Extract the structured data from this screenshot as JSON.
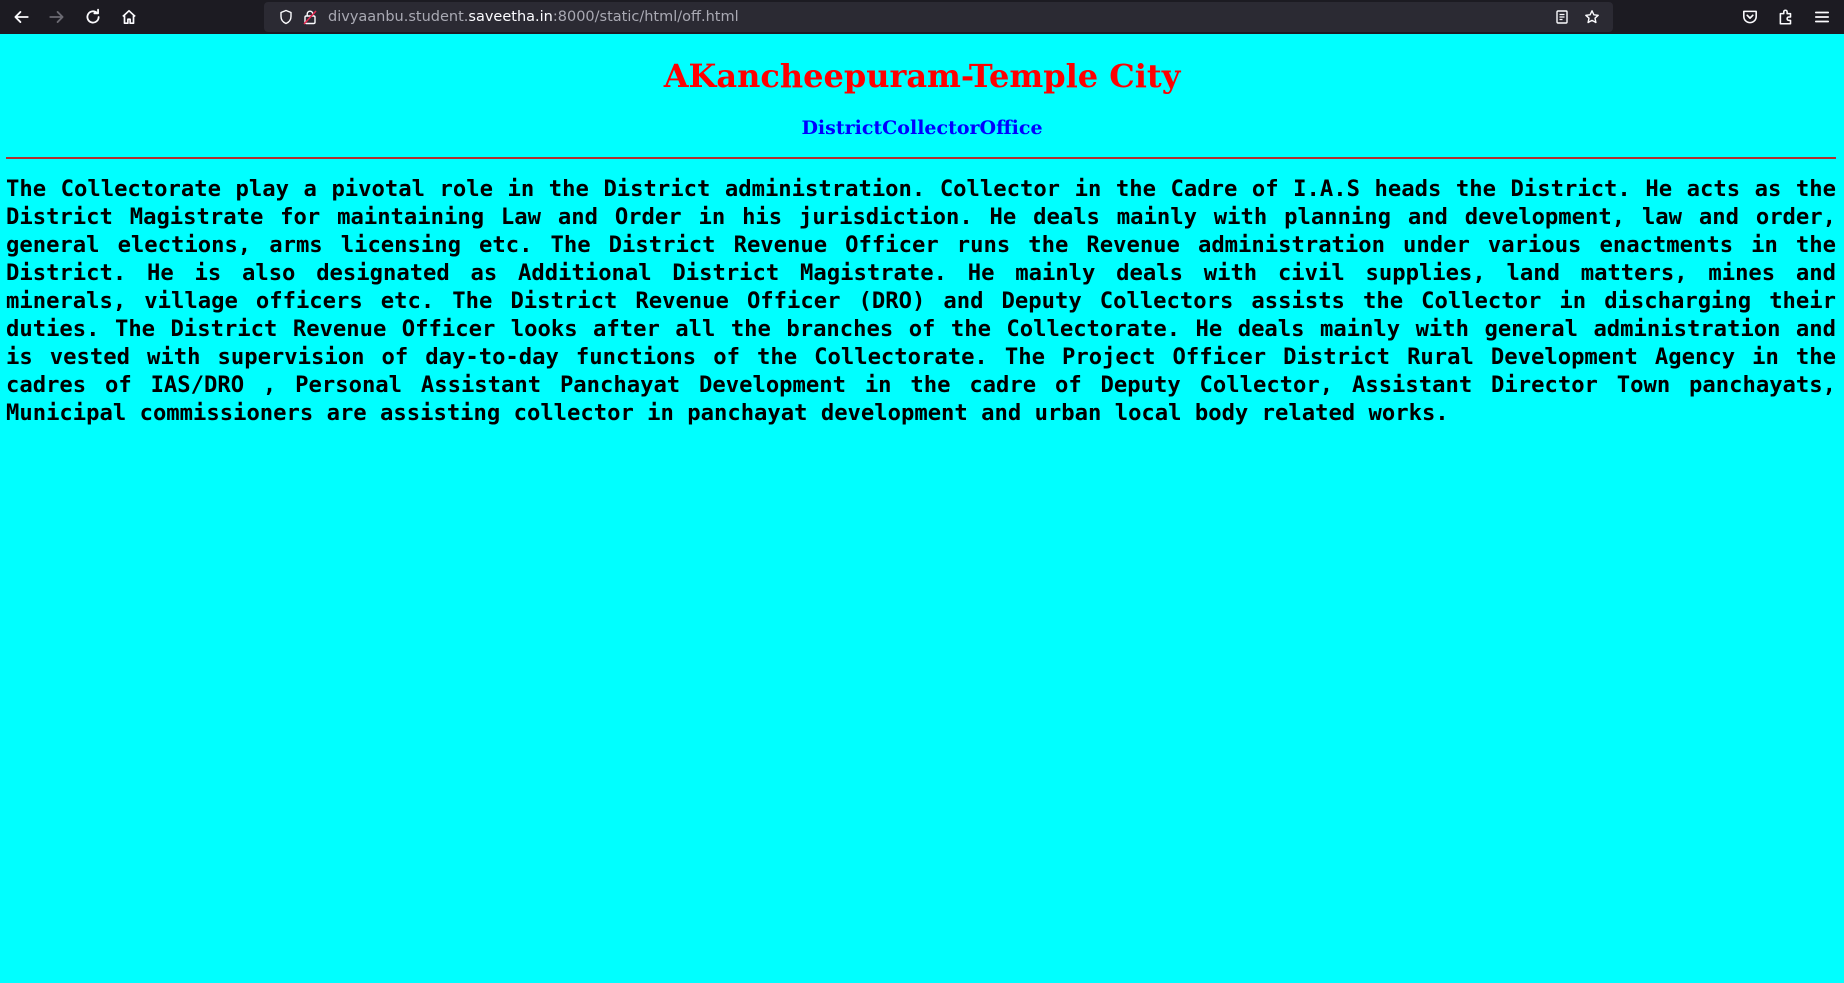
{
  "browser": {
    "url_prefix": "divyaanbu.student.",
    "url_host": "saveetha.in",
    "url_suffix": ":8000/static/html/off.html",
    "icons": {
      "back": "back-arrow-icon",
      "forward": "forward-arrow-icon",
      "reload": "reload-icon",
      "home": "home-icon",
      "tracking": "shield-icon",
      "connection": "insecure-lock-icon",
      "reader": "reader-view-icon",
      "bookmark": "star-icon",
      "pocket": "pocket-icon",
      "extensions": "extensions-icon",
      "menu": "hamburger-menu-icon"
    }
  },
  "page": {
    "title": "AKancheepuram-Temple City",
    "subtitle": "DistrictCollectorOffice",
    "body": "The Collectorate play a pivotal role in the District administration. Collector in the Cadre of I.A.S heads the District. He acts as the District Magistrate for maintaining Law and Order in his jurisdiction. He deals mainly with planning and development, law and order, general elections, arms licensing etc. The District Revenue Officer runs the Revenue administration under various enactments in the District. He is also designated as Additional District Magistrate. He mainly deals with civil supplies, land matters, mines and minerals, village officers etc. The District Revenue Officer (DRO) and Deputy Collectors assists the Collector in discharging their duties. The District Revenue Officer looks after all the branches of the Collectorate. He deals mainly with general administration and is vested with supervision of day-to-day functions of the Collectorate. The Project Officer District Rural Development Agency in the cadres of IAS/DRO , Personal Assistant Panchayat Development in the cadre of Deputy Collector, Assistant Director Town panchayats, Municipal commissioners are assisting collector in panchayat development and urban local body related works.",
    "colors": {
      "background": "#00ffff",
      "title": "#ff0000",
      "subtitle": "#0000ff",
      "rule": "#b03030"
    }
  }
}
